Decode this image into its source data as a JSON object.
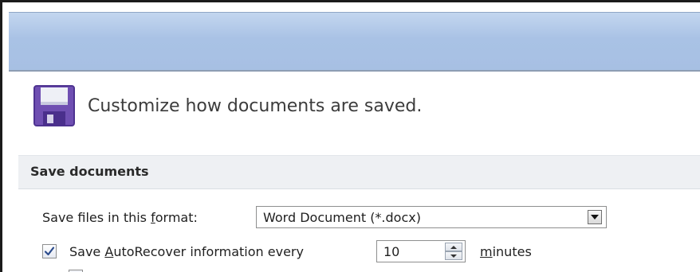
{
  "header": {
    "text": "Customize how documents are saved.",
    "icon": "floppy-disk-icon"
  },
  "section": {
    "title": "Save documents"
  },
  "format_row": {
    "label_pre": "Save files in this ",
    "label_accel": "f",
    "label_post": "ormat:",
    "value": "Word Document (*.docx)"
  },
  "autorecover_row": {
    "checked": true,
    "label_pre": "Save ",
    "label_accel": "A",
    "label_post": "utoRecover information every",
    "value": "10",
    "unit_accel": "m",
    "unit_post": "inutes"
  },
  "colors": {
    "titlebar": "#a9c2e5",
    "section_bg": "#eef0f3",
    "icon_purple": "#6f4fb2",
    "check_blue": "#2b4b8c"
  }
}
